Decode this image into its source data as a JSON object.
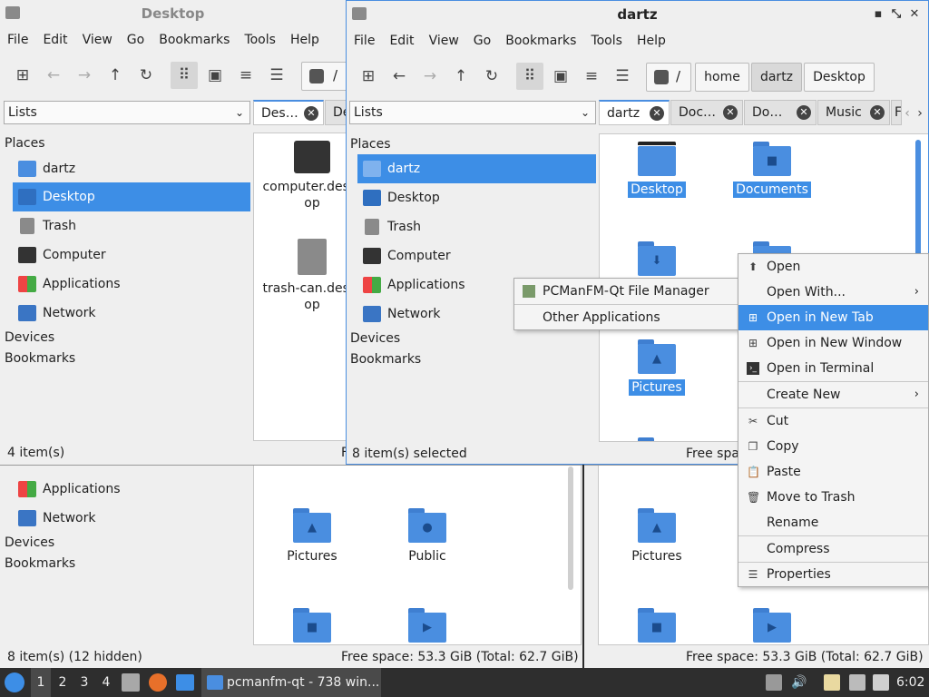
{
  "menus": [
    "File",
    "Edit",
    "View",
    "Go",
    "Bookmarks",
    "Tools",
    "Help"
  ],
  "lists_combo": "Lists",
  "sidebar": {
    "places": "Places",
    "devices": "Devices",
    "bookmarks": "Bookmarks",
    "items": [
      "dartz",
      "Desktop",
      "Trash",
      "Computer",
      "Applications",
      "Network"
    ]
  },
  "win_left": {
    "title": "Desktop",
    "tabs": [
      "Des…",
      "De"
    ],
    "files": [
      "computer.desktop",
      "trash-can.desktop"
    ],
    "status": "4 item(s)",
    "status_right": "F"
  },
  "win_back_left": {
    "status": "8 item(s) (12 hidden)",
    "free": "Free space: 53.3 GiB (Total: 62.7 GiB)",
    "files": [
      "Pictures",
      "Public"
    ]
  },
  "win_back_right": {
    "free": "Free space: 53.3 GiB (Total: 62.7 GiB)",
    "files": [
      "Pictures"
    ]
  },
  "win_main": {
    "title": "dartz",
    "breadcrumb": [
      "home",
      "dartz",
      "Desktop"
    ],
    "path_root": "/",
    "tabs": [
      "dartz",
      "Doc…",
      "Do…",
      "Music",
      "F"
    ],
    "files": [
      "Desktop",
      "Documents",
      "Pictures"
    ],
    "status": "8 item(s) selected",
    "free": "Free spa"
  },
  "open_with_menu": [
    "PCManFM-Qt File Manager",
    "Other Applications"
  ],
  "context_menu": {
    "open": "Open",
    "open_with": "Open With...",
    "open_new_tab": "Open in New Tab",
    "open_new_window": "Open in New Window",
    "open_terminal": "Open in Terminal",
    "create_new": "Create New",
    "cut": "Cut",
    "copy": "Copy",
    "paste": "Paste",
    "move_trash": "Move to Trash",
    "rename": "Rename",
    "compress": "Compress",
    "properties": "Properties"
  },
  "taskbar": {
    "workspaces": [
      "1",
      "2",
      "3",
      "4"
    ],
    "task": "pcmanfm-qt - 738 win...",
    "clock": "6:02"
  },
  "colors": {
    "accent": "#3d8ee6",
    "folder": "#4a8ee0",
    "taskbar": "#2e2e2e"
  }
}
